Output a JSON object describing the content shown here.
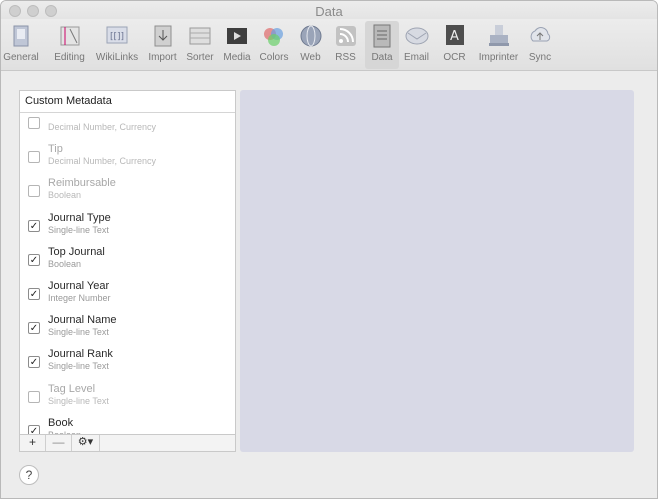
{
  "window": {
    "title": "Data"
  },
  "toolbar": {
    "items": [
      {
        "label": "General",
        "icon": "general-icon"
      },
      {
        "label": "Editing",
        "icon": "editing-icon"
      },
      {
        "label": "WikiLinks",
        "icon": "wikilinks-icon"
      },
      {
        "label": "Import",
        "icon": "import-icon"
      },
      {
        "label": "Sorter",
        "icon": "sorter-icon"
      },
      {
        "label": "Media",
        "icon": "media-icon"
      },
      {
        "label": "Colors",
        "icon": "colors-icon"
      },
      {
        "label": "Web",
        "icon": "web-icon"
      },
      {
        "label": "RSS",
        "icon": "rss-icon"
      },
      {
        "label": "Data",
        "icon": "data-icon",
        "active": true
      },
      {
        "label": "Email",
        "icon": "email-icon"
      },
      {
        "label": "OCR",
        "icon": "ocr-icon"
      },
      {
        "label": "Imprinter",
        "icon": "imprinter-icon"
      },
      {
        "label": "Sync",
        "icon": "sync-icon"
      }
    ]
  },
  "metadata_panel": {
    "header": "Custom Metadata",
    "items": [
      {
        "name": "",
        "type": "Decimal Number, Currency",
        "checked": false,
        "enabled": false
      },
      {
        "name": "Tip",
        "type": "Decimal Number, Currency",
        "checked": false,
        "enabled": false
      },
      {
        "name": "Reimbursable",
        "type": "Boolean",
        "checked": false,
        "enabled": false
      },
      {
        "name": "Journal Type",
        "type": "Single-line Text",
        "checked": true,
        "enabled": true
      },
      {
        "name": "Top Journal",
        "type": "Boolean",
        "checked": true,
        "enabled": true
      },
      {
        "name": "Journal Year",
        "type": "Integer Number",
        "checked": true,
        "enabled": true
      },
      {
        "name": "Journal Name",
        "type": "Single-line Text",
        "checked": true,
        "enabled": true
      },
      {
        "name": "Journal Rank",
        "type": "Single-line Text",
        "checked": true,
        "enabled": true
      },
      {
        "name": "Tag Level",
        "type": "Single-line Text",
        "checked": false,
        "enabled": false
      },
      {
        "name": "Book",
        "type": "Boolean",
        "checked": true,
        "enabled": true
      }
    ],
    "checkmark": "✓",
    "add_label": "+",
    "remove_label": "—",
    "action_label": "⚙▾"
  },
  "help": {
    "label": "?"
  }
}
